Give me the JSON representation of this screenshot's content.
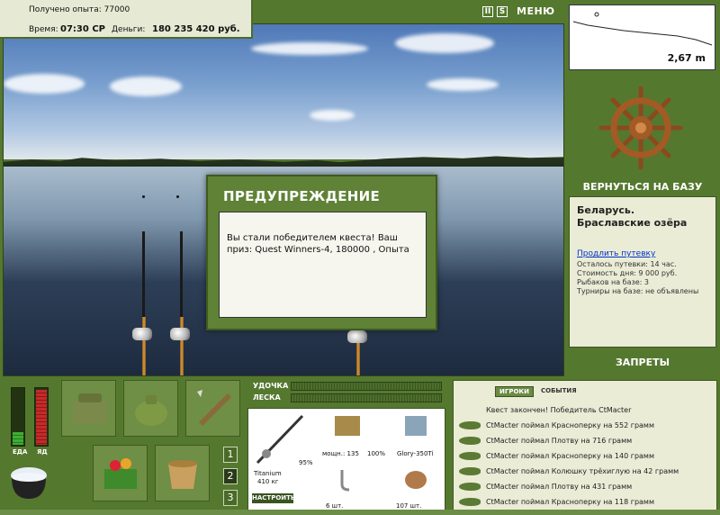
{
  "header": {
    "xp_label": "Получено опыта:",
    "xp_value": "77000",
    "time_label": "Время:",
    "time_value": "07:30 СР",
    "money_label": "Деньги:",
    "money_value": "180 235 420 руб."
  },
  "top_controls": {
    "pause_glyph": "II",
    "sound_glyph": "S",
    "menu_label": "МЕНЮ"
  },
  "depth": {
    "value": "2,67 m"
  },
  "right_panel": {
    "return_label": "ВЕРНУТЬСЯ НА БАЗУ",
    "location_title": "Беларусь. Браславские озёра",
    "extend_link": "Продлить путевку",
    "lines": [
      "Осталось путевки: 14 час.",
      "Стоимость дня: 9 000 руб.",
      "Рыбаков на базе: 3",
      "Турниры на базе: не объявлены"
    ],
    "bans_label": "ЗАПРЕТЫ"
  },
  "dialog": {
    "title": "ПРЕДУПРЕЖДЕНИЕ",
    "message": "Вы стали победителем квеста! Ваш приз: Quest Winners-4, 180000 , Опыта"
  },
  "status": {
    "food_label": "ЕДА",
    "poison_label": "ЯД",
    "food_level": 0.22,
    "poison_level": 0.95
  },
  "inventory_tabs": [
    "1",
    "2",
    "3"
  ],
  "tackle": {
    "rod_label": "УДОЧКА",
    "line_label": "ЛЕСКА",
    "rod_name": "Titanium",
    "rod_weight": "410 кг",
    "rod_percent": "95%",
    "reel_power": "мощн.: 135",
    "reel_percent": "100%",
    "line_name": "Glory-350Ti",
    "hook_count": "6 шт.",
    "bait_count": "107 шт.",
    "setup_button": "НАСТРОИТЬ"
  },
  "events": {
    "tab_players": "ИГРОКИ",
    "tab_events": "СОБЫТИЯ",
    "header_line": "Квест закончен! Победитель CtMacter",
    "items": [
      "CtMacter поймал Красноперку на 552 грамм",
      "CtMacter поймал Плотву на 716 грамм",
      "CtMacter поймал Красноперку на 140 грамм",
      "CtMacter поймал Колюшку трёхиглую на 42 грамм",
      "CtMacter поймал Плотву на 431 грамм",
      "CtMacter поймал Красноперку на 118 грамм"
    ]
  },
  "colors": {
    "panel_green": "#55782f",
    "panel_light": "#eaecd6",
    "poison_red": "#c62a2a",
    "food_green": "#3fae32"
  }
}
